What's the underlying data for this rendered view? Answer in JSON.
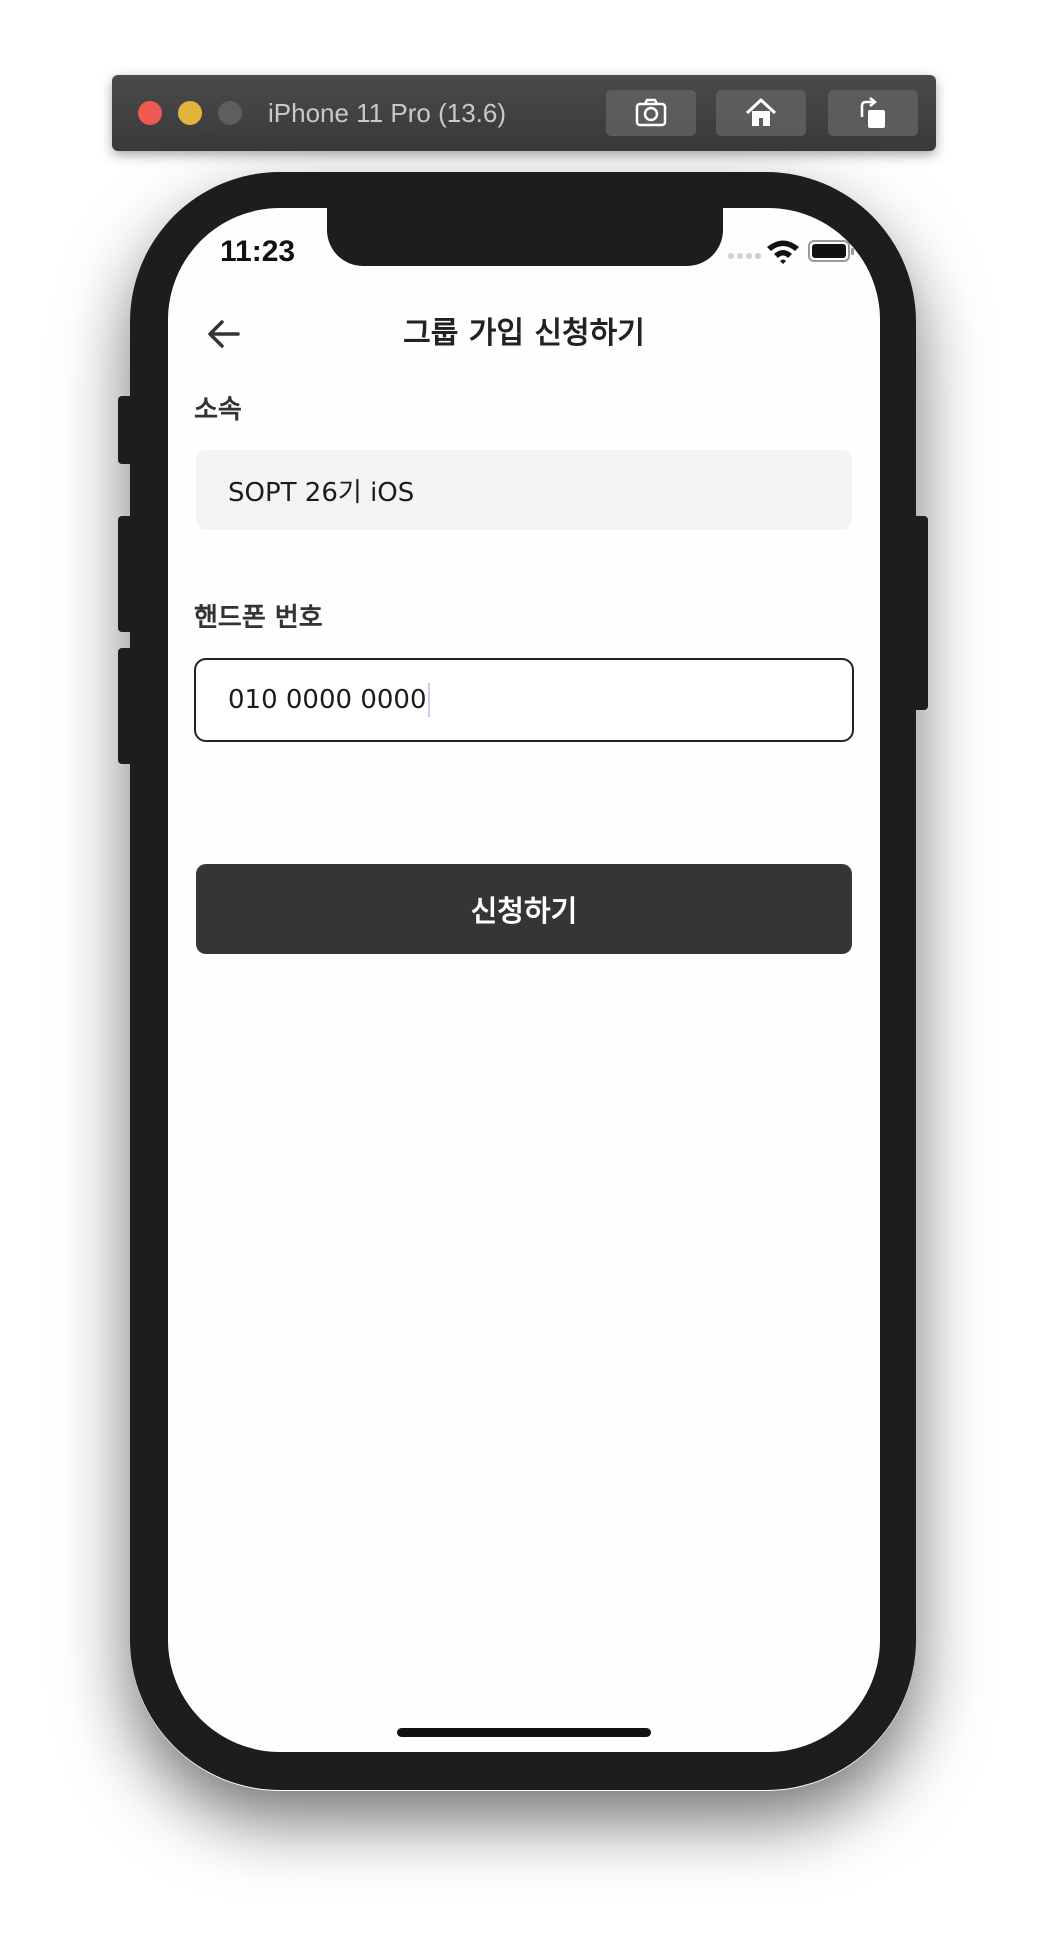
{
  "simulator": {
    "title": "iPhone 11 Pro (13.6)",
    "buttons": [
      "screenshot-icon",
      "home-icon",
      "rotate-icon"
    ]
  },
  "status_bar": {
    "time": "11:23"
  },
  "nav": {
    "back_icon": "arrow-left-icon",
    "title": "그룹 가입 신청하기"
  },
  "form": {
    "affiliation_label": "소속",
    "affiliation_value": "SOPT 26기 iOS",
    "phone_label": "핸드폰 번호",
    "phone_value": "010 0000 0000"
  },
  "submit": {
    "label": "신청하기"
  },
  "colors": {
    "button_bg": "#353535",
    "field_bg": "#f2f3f5",
    "input_border": "#222222"
  }
}
